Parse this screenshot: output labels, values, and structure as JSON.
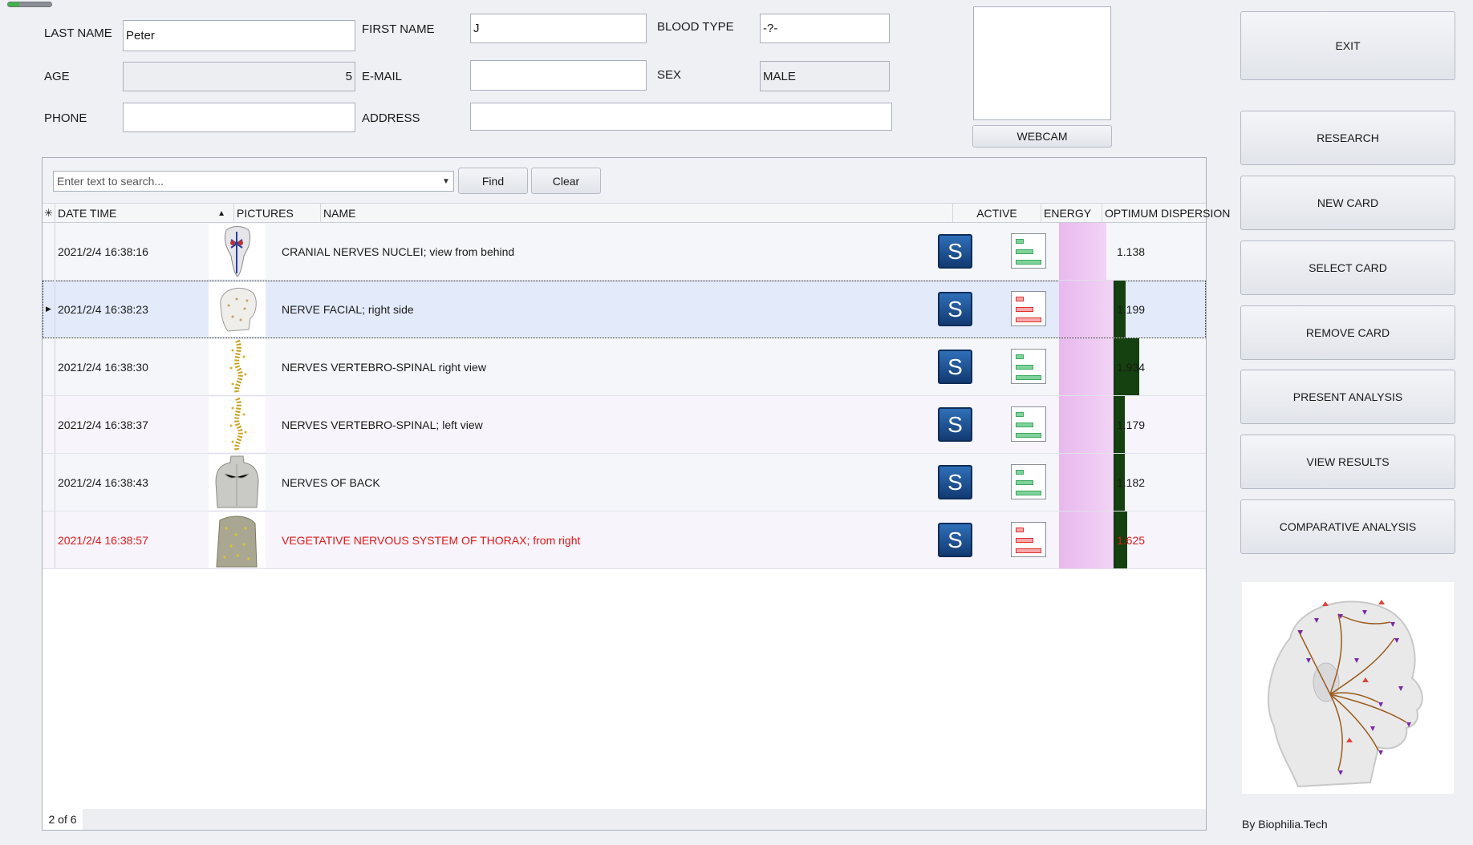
{
  "colors": {
    "accent_blue": "#1f4f8f",
    "alert_red": "#e01818",
    "dispersion_pink": "#e8b8ee",
    "dispersion_green": "#15400f"
  },
  "progress": {
    "value_fraction": 0.25
  },
  "patient": {
    "last_name_label": "LAST NAME",
    "last_name_value": "Peter",
    "first_name_label": "FIRST NAME",
    "first_name_value": "J",
    "blood_type_label": "BLOOD TYPE",
    "blood_type_value": "-?-",
    "age_label": "AGE",
    "age_value": "5",
    "email_label": "E-MAIL",
    "email_value": "",
    "sex_label": "SEX",
    "sex_value": "MALE",
    "phone_label": "PHONE",
    "phone_value": "",
    "address_label": "ADDRESS",
    "address_value": ""
  },
  "webcam": {
    "button_label": "WEBCAM"
  },
  "sidebar": {
    "buttons": [
      "EXIT",
      "RESEARCH",
      "NEW CARD",
      "SELECT CARD",
      "REMOVE CARD",
      "PRESENT ANALYSIS",
      "VIEW RESULTS",
      "COMPARATIVE ANALYSIS"
    ],
    "credit": "By Biophilia.Tech",
    "head_image_icon": "head-nerve-map-icon"
  },
  "search": {
    "placeholder": "Enter text to search...",
    "find_label": "Find",
    "clear_label": "Clear"
  },
  "table": {
    "columns": {
      "date_time": "DATE TIME",
      "pictures": "PICTURES",
      "name": "NAME",
      "active": "ACTIVE",
      "energy": "ENERGY",
      "dispersion": "OPTIMUM DISPERSION"
    },
    "active_glyph": "S",
    "rows": [
      {
        "date": "2021/2/4 16:38:16",
        "name": "CRANIAL NERVES NUCLEI; view from behind",
        "dispersion": "1.138",
        "energy": "green",
        "alert": false,
        "selected": false,
        "pink_fill": 0.32,
        "green_fill": 0.0,
        "picture_icon": "brain-stem-icon"
      },
      {
        "date": "2021/2/4 16:38:23",
        "name": "NERVE FACIAL; right side",
        "dispersion": "1.199",
        "energy": "red",
        "alert": false,
        "selected": true,
        "pink_fill": 0.37,
        "green_fill": 0.08,
        "picture_icon": "skull-icon"
      },
      {
        "date": "2021/2/4 16:38:30",
        "name": "NERVES VERTEBRO-SPINAL right view",
        "dispersion": "1.934",
        "energy": "green",
        "alert": false,
        "selected": false,
        "pink_fill": 0.37,
        "green_fill": 0.17,
        "picture_icon": "spine-icon"
      },
      {
        "date": "2021/2/4 16:38:37",
        "name": "NERVES VERTEBRO-SPINAL; left view",
        "dispersion": "1.179",
        "energy": "green",
        "alert": false,
        "selected": false,
        "pink_fill": 0.37,
        "green_fill": 0.07,
        "picture_icon": "spine-icon"
      },
      {
        "date": "2021/2/4 16:38:43",
        "name": "NERVES OF BACK",
        "dispersion": "1.182",
        "energy": "green",
        "alert": false,
        "selected": false,
        "pink_fill": 0.37,
        "green_fill": 0.07,
        "picture_icon": "back-torso-icon"
      },
      {
        "date": "2021/2/4 16:38:57",
        "name": "VEGETATIVE NERVOUS SYSTEM OF THORAX; from right",
        "dispersion": "1.625",
        "energy": "red",
        "alert": true,
        "selected": false,
        "pink_fill": 0.37,
        "green_fill": 0.09,
        "picture_icon": "thorax-icon"
      }
    ]
  },
  "status": {
    "page_info": "2 of 6"
  }
}
